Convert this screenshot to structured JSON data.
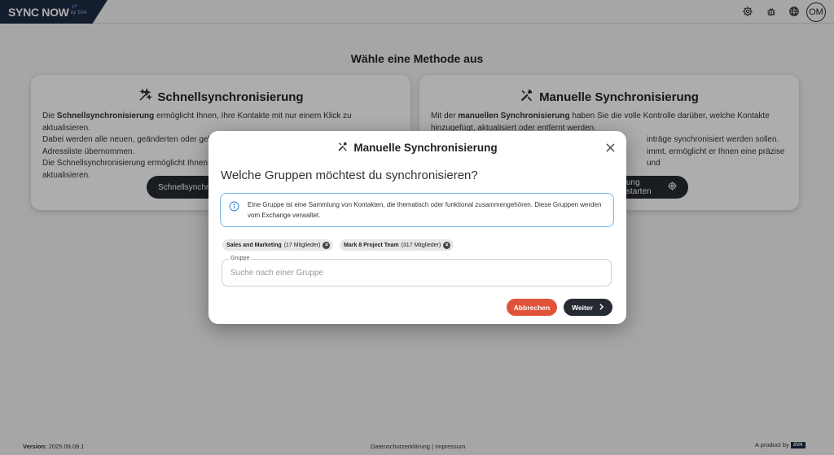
{
  "header": {
    "logo_text": "SYNC NOW",
    "logo_sub": "by SVA",
    "avatar_initials": "OM",
    "icons": [
      "settings-icon",
      "bug-icon",
      "globe-icon"
    ]
  },
  "main": {
    "title": "Wähle eine Methode aus",
    "cards": [
      {
        "title": "Schnellsynchronisierung",
        "icon": "magic-wand-icon",
        "text_lines": [
          {
            "pre": "Die ",
            "bold": "Schnellsynchronisierung",
            "post": " ermöglicht Ihnen, Ihre Kontakte mit nur einem Klick zu aktualisieren."
          },
          {
            "pre": "Dabei werden alle neuen, geänderten oder gelöschten Einträge automatisch aus der der globalen",
            "bold": "",
            "post": ""
          },
          {
            "pre": "Adressliste übernommen.",
            "bold": "",
            "post": ""
          },
          {
            "pre": "Die Schnellsynchronisierung ermöglicht Ihnen,",
            "bold": "",
            "post": ""
          },
          {
            "pre": "aktualisieren.",
            "bold": "",
            "post": ""
          }
        ],
        "button_label": "Schnellsynchr"
      },
      {
        "title": "Manuelle Synchronisierung",
        "icon": "tools-icon",
        "text_lines": [
          {
            "pre": "Mit der ",
            "bold": "manuellen Synchronisierung",
            "post": " haben Sie die volle Kontrolle darüber, welche Kontakte"
          },
          {
            "pre": "hinzugefügt, aktualisiert oder entfernt werden.",
            "bold": "",
            "post": ""
          },
          {
            "pre": "inträge synchronisiert werden sollen.",
            "bold": "",
            "post": ""
          },
          {
            "pre": "immt, ermöglicht er Ihnen eine präzise und",
            "bold": "",
            "post": ""
          }
        ],
        "button_label": "ung starten"
      }
    ]
  },
  "footer": {
    "version_label": "Version:",
    "version": "2025.09.09.1",
    "privacy": "Datenschutzerklärung",
    "separator": "|",
    "imprint": "Impressum",
    "product": "A product by",
    "product_badge": "SVA"
  },
  "modal": {
    "title": "Manuelle Synchronisierung",
    "icon": "tools-icon",
    "question": "Welche Gruppen möchtest du synchronisieren?",
    "info": "Eine Gruppe ist eine Sammlung von Kontakten, die thematisch oder funktional zusammengehören. Diese Gruppen werden vom Exchange verwaltet.",
    "chips": [
      {
        "name": "Sales and Marketing",
        "members": "(17 Mitglieder)"
      },
      {
        "name": "Mark 8 Project Team",
        "members": "(317 Mitglieder)"
      }
    ],
    "field_label": "Gruppe",
    "field_placeholder": "Suche nach einer Gruppe",
    "field_value": "",
    "cancel_label": "Abbrechen",
    "next_label": "Weiter"
  },
  "colors": {
    "logo_bg": "#1d2b45",
    "button_dark": "#262a32",
    "cancel_red": "#e0533a",
    "info_border": "#7bb3e0"
  }
}
